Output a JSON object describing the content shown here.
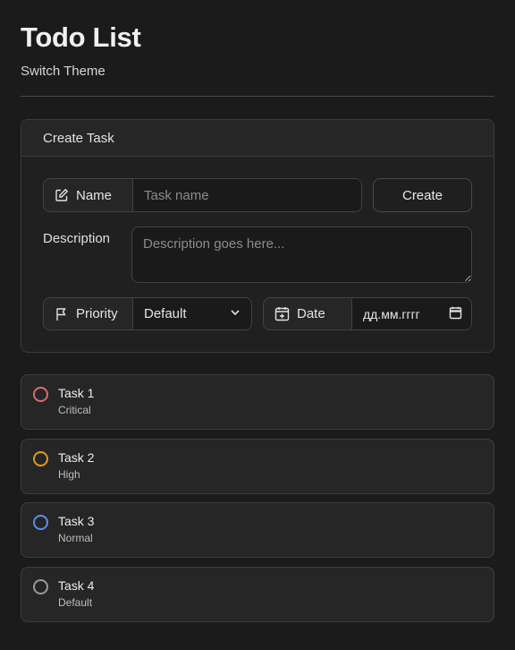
{
  "app": {
    "title": "Todo List",
    "theme_link": "Switch Theme"
  },
  "create_card": {
    "header": "Create Task",
    "name_label": "Name",
    "name_placeholder": "Task name",
    "create_button": "Create",
    "description_label": "Description",
    "description_placeholder": "Description goes here...",
    "priority_label": "Priority",
    "priority_value": "Default",
    "date_label": "Date",
    "date_placeholder": "дд.мм.гггг"
  },
  "tasks": [
    {
      "name": "Task 1",
      "priority": "Critical",
      "color": "#e06a6a"
    },
    {
      "name": "Task 2",
      "priority": "High",
      "color": "#e29b1f"
    },
    {
      "name": "Task 3",
      "priority": "Normal",
      "color": "#5b8fe8"
    },
    {
      "name": "Task 4",
      "priority": "Default",
      "color": "#9a9a9a"
    }
  ],
  "icons": {
    "name": "edit-icon",
    "priority": "flag-icon",
    "date": "calendar-plus-icon",
    "select": "chevron-down-icon",
    "date_picker": "calendar-icon"
  }
}
